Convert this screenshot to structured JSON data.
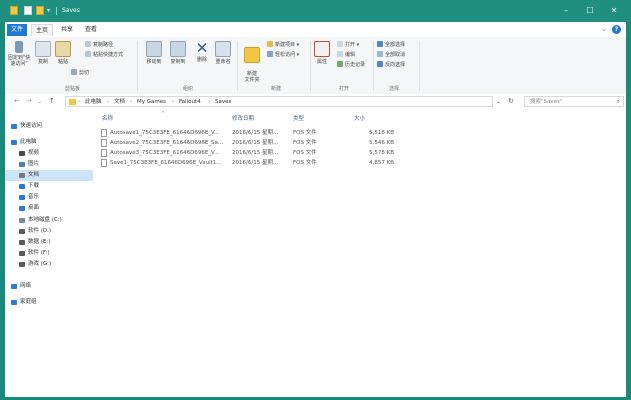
{
  "window": {
    "title": "Saves",
    "minimize": "–",
    "maximize": "☐",
    "close": "✕",
    "frame_color": "#1f8f80"
  },
  "ribbon_tabs": {
    "file": "文件",
    "home": "主页",
    "share": "共享",
    "view": "查看",
    "collapse": "⌄",
    "help": "?"
  },
  "ribbon": {
    "clipboard": {
      "pin": "固定到\"快速访问\"",
      "copy": "复制",
      "paste": "粘贴",
      "copy_path": "复制路径",
      "paste_shortcut": "粘贴快捷方式",
      "cut": "剪切",
      "label": "剪贴板"
    },
    "organize": {
      "move_to": "移动到",
      "copy_to": "复制到",
      "delete": "删除",
      "rename": "重命名",
      "label": "组织"
    },
    "new": {
      "new_folder": "新建\n文件夹",
      "new_item": "新建项目 ▾",
      "easy_access": "轻松访问 ▾",
      "label": "新建"
    },
    "open": {
      "properties": "属性",
      "open": "打开 ▾",
      "edit": "编辑",
      "history": "历史记录",
      "label": "打开"
    },
    "select": {
      "select_all": "全部选择",
      "select_none": "全部取消",
      "invert": "反向选择",
      "label": "选择"
    }
  },
  "address": {
    "back": "←",
    "forward": "→",
    "recent": "⌄",
    "up": "↑",
    "breadcrumbs": [
      "此电脑",
      "文档",
      "My Games",
      "Fallout4",
      "Saves"
    ],
    "dropdown": "⌄",
    "refresh": "↻",
    "search_placeholder": "搜索\"Saves\"",
    "search_icon": "⌕"
  },
  "nav": {
    "items": [
      {
        "label": "快速访问",
        "icon": "star-icon",
        "color": "#2b7bd6"
      },
      {
        "label": "此电脑",
        "icon": "computer-icon",
        "color": "#2b7bd6"
      },
      {
        "label": "视频",
        "icon": "video-icon",
        "color": "#4a4a4a"
      },
      {
        "label": "图片",
        "icon": "picture-icon",
        "color": "#4a7fb0"
      },
      {
        "label": "文档",
        "icon": "document-icon",
        "color": "#7a7a7a"
      },
      {
        "label": "下载",
        "icon": "download-icon",
        "color": "#2b7bd6"
      },
      {
        "label": "音乐",
        "icon": "music-icon",
        "color": "#2b7bd6"
      },
      {
        "label": "桌面",
        "icon": "desktop-icon",
        "color": "#2b7bd6"
      },
      {
        "label": "本地磁盘 (C:)",
        "icon": "drive-icon",
        "color": "#7a8a9a"
      },
      {
        "label": "软件 (D:)",
        "icon": "drive-icon",
        "color": "#5a5a5a"
      },
      {
        "label": "数据 (E:)",
        "icon": "drive-icon",
        "color": "#5a5a5a"
      },
      {
        "label": "软件 (F:)",
        "icon": "drive-icon",
        "color": "#5a5a5a"
      },
      {
        "label": "游戏 (G:)",
        "icon": "drive-icon",
        "color": "#5a5a5a"
      },
      {
        "label": "网络",
        "icon": "network-icon",
        "color": "#2b7bd6"
      },
      {
        "label": "家庭组",
        "icon": "homegroup-icon",
        "color": "#2b7bd6"
      }
    ],
    "selected_index": 4
  },
  "list": {
    "headers": {
      "name": "名称",
      "date": "修改日期",
      "type": "类型",
      "size": "大小"
    },
    "sort_caret": "^",
    "rows": [
      {
        "name": "Autosave1_75C3E3FE_61646D696E_V...",
        "date": "2016/6/15 星期...",
        "type": "FOS 文件",
        "size": "5,518 KB"
      },
      {
        "name": "Autosave2_75C3E3FE_61646D696E_Sa...",
        "date": "2016/6/15 星期...",
        "type": "FOS 文件",
        "size": "5,546 KB"
      },
      {
        "name": "Autosave3_75C3E3FE_61646D696E_V...",
        "date": "2016/6/15 星期...",
        "type": "FOS 文件",
        "size": "5,578 KB"
      },
      {
        "name": "Save1_75C3E3FE_61646D696E_Vault1...",
        "date": "2016/6/15 星期...",
        "type": "FOS 文件",
        "size": "4,857 KB"
      }
    ]
  }
}
